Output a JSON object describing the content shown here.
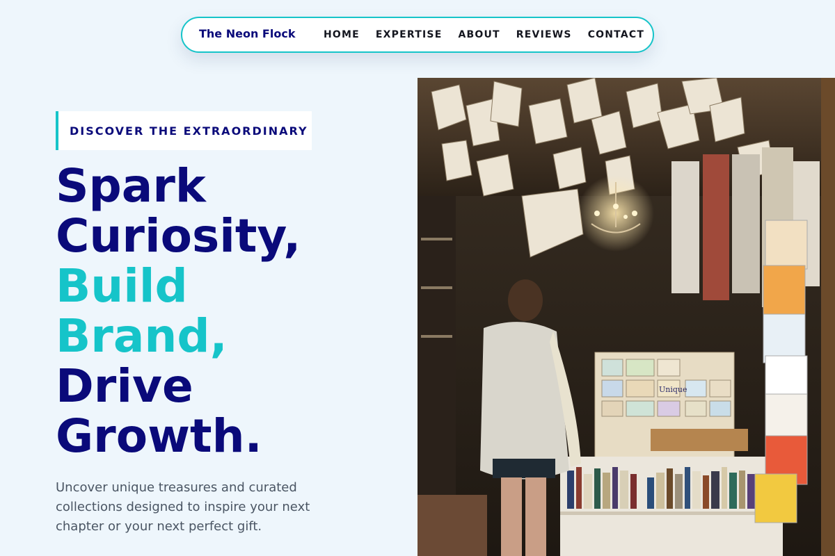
{
  "nav": {
    "brand": "The Neon Flock",
    "links": [
      "HOME",
      "EXPERTISE",
      "ABOUT",
      "REVIEWS",
      "CONTACT"
    ]
  },
  "hero": {
    "eyebrow": "DISCOVER THE EXTRAORDINARY",
    "headline": {
      "line1": "Spark",
      "line2": "Curiosity,",
      "line3": "Build",
      "line4": "Brand,",
      "line5": "Drive",
      "line6": "Growth."
    },
    "subtext": "Uncover unique treasures and curated collections designed to inspire your next chapter or your next perfect gift.",
    "image": {
      "description_icon": "bookshop-photo",
      "overlay_text": "Unique"
    }
  },
  "colors": {
    "navy": "#0a0a7a",
    "accent": "#16c4c9",
    "background": "#eef6fc",
    "body_text": "#4a5563"
  }
}
